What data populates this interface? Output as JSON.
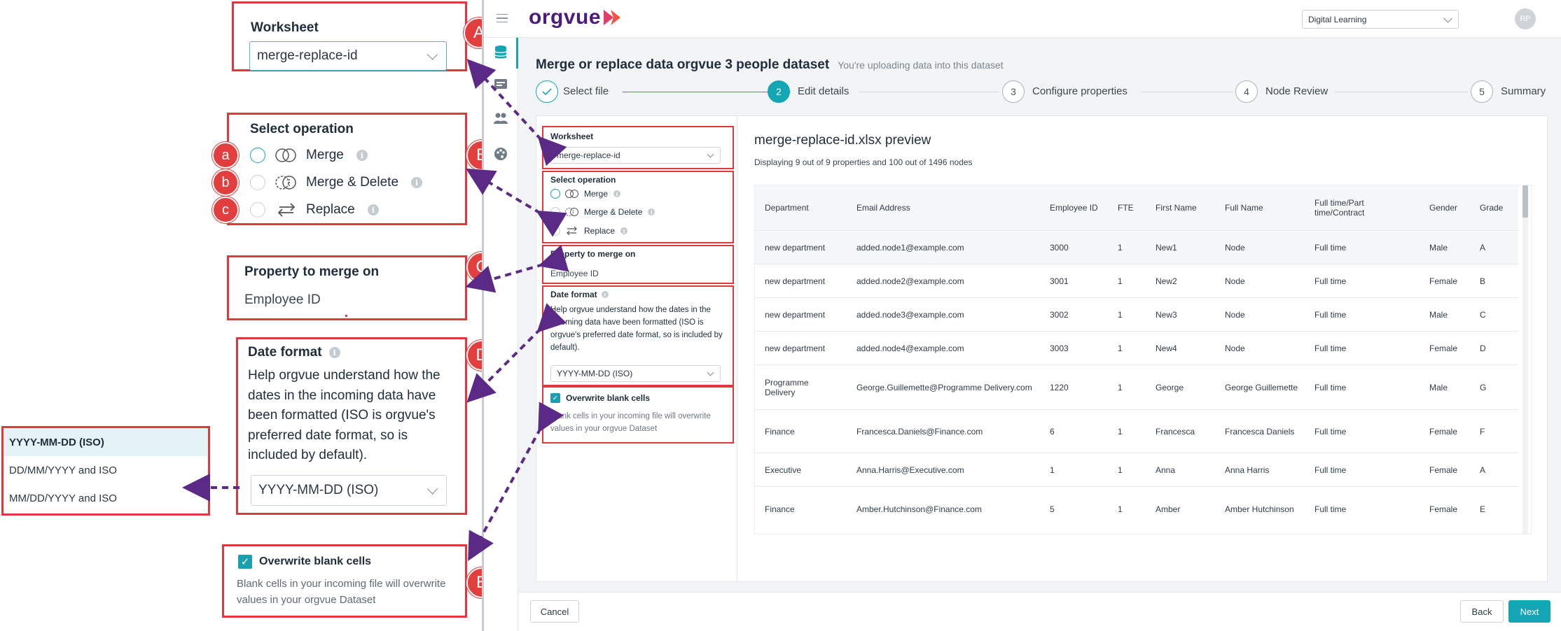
{
  "app": {
    "logo_text": "orgvue",
    "workspace_select": "Digital Learning",
    "avatar_initials": "RP",
    "title": "Merge or replace data orgvue 3 people dataset",
    "subtitle": "You're uploading data into this dataset",
    "steps": [
      {
        "num": "",
        "label": "Select file",
        "state": "done"
      },
      {
        "num": "2",
        "label": "Edit details",
        "state": "active"
      },
      {
        "num": "3",
        "label": "Configure properties",
        "state": "todo"
      },
      {
        "num": "4",
        "label": "Node Review",
        "state": "todo"
      },
      {
        "num": "5",
        "label": "Summary",
        "state": "todo"
      }
    ],
    "form": {
      "worksheet_label": "Worksheet",
      "worksheet_value": "merge-replace-id",
      "operation_label": "Select operation",
      "op_merge": "Merge",
      "op_merge_delete": "Merge & Delete",
      "op_replace": "Replace",
      "property_label": "Property to merge on",
      "property_value": "Employee ID",
      "date_label": "Date format",
      "date_help": "Help orgvue understand how the dates in the incoming data have been formatted (ISO is orgvue's preferred date format, so is included by default).",
      "date_value": "YYYY-MM-DD (ISO)",
      "overwrite_label": "Overwrite blank cells",
      "overwrite_help": "Blank cells in your incoming file will overwrite values in your orgvue Dataset"
    },
    "preview": {
      "title": "merge-replace-id.xlsx preview",
      "summary": "Displaying 9 out of 9 properties and 100 out of 1496 nodes",
      "columns": [
        "Department",
        "Email Address",
        "Employee ID",
        "FTE",
        "First Name",
        "Full Name",
        "Full time/Part time/Contract",
        "Gender",
        "Grade"
      ],
      "rows": [
        [
          "new department",
          "added.node1@example.com",
          "3000",
          "1",
          "New1",
          "Node",
          "Full time",
          "Male",
          "A"
        ],
        [
          "new department",
          "added.node2@example.com",
          "3001",
          "1",
          "New2",
          "Node",
          "Full time",
          "Female",
          "B"
        ],
        [
          "new department",
          "added.node3@example.com",
          "3002",
          "1",
          "New3",
          "Node",
          "Full time",
          "Male",
          "C"
        ],
        [
          "new department",
          "added.node4@example.com",
          "3003",
          "1",
          "New4",
          "Node",
          "Full time",
          "Female",
          "D"
        ],
        [
          "Programme Delivery",
          "George.Guillemette@Programme Delivery.com",
          "1220",
          "1",
          "George",
          "George Guillemette",
          "Full time",
          "Male",
          "G"
        ],
        [
          "Finance",
          "Francesca.Daniels@Finance.com",
          "6",
          "1",
          "Francesca",
          "Francesca Daniels",
          "Full time",
          "Female",
          "F"
        ],
        [
          "Executive",
          "Anna.Harris@Executive.com",
          "1",
          "1",
          "Anna",
          "Anna Harris",
          "Full time",
          "Female",
          "A"
        ],
        [
          "Finance",
          "Amber.Hutchinson@Finance.com",
          "5",
          "1",
          "Amber",
          "Amber Hutchinson",
          "Full time",
          "Female",
          "E"
        ]
      ]
    },
    "footer": {
      "cancel": "Cancel",
      "back": "Back",
      "next": "Next"
    }
  },
  "callouts": {
    "A": {
      "badge": "A",
      "label": "Worksheet",
      "value": "merge-replace-id"
    },
    "B": {
      "badge": "B",
      "label": "Select operation",
      "items": [
        {
          "badge": "a",
          "label": "Merge"
        },
        {
          "badge": "b",
          "label": "Merge & Delete"
        },
        {
          "badge": "c",
          "label": "Replace"
        }
      ]
    },
    "C": {
      "badge": "C",
      "label": "Property to merge on",
      "value": "Employee ID"
    },
    "D": {
      "badge": "D",
      "label": "Date format",
      "help": "Help orgvue understand how the dates in the incoming data have been formatted (ISO is orgvue's preferred date format, so is included by default).",
      "value": "YYYY-MM-DD (ISO)"
    },
    "E": {
      "badge": "E",
      "label": "Overwrite blank cells",
      "help": "Blank cells in your incoming file will overwrite values in your orgvue Dataset"
    },
    "date_options": [
      "YYYY-MM-DD (ISO)",
      "DD/MM/YYYY and ISO",
      "MM/DD/YYYY and ISO"
    ]
  },
  "colors": {
    "accent": "#15a6b5",
    "callout_red": "#e2373c",
    "arrow_purple": "#5b2a86",
    "logo_purple": "#4b1d7a"
  }
}
